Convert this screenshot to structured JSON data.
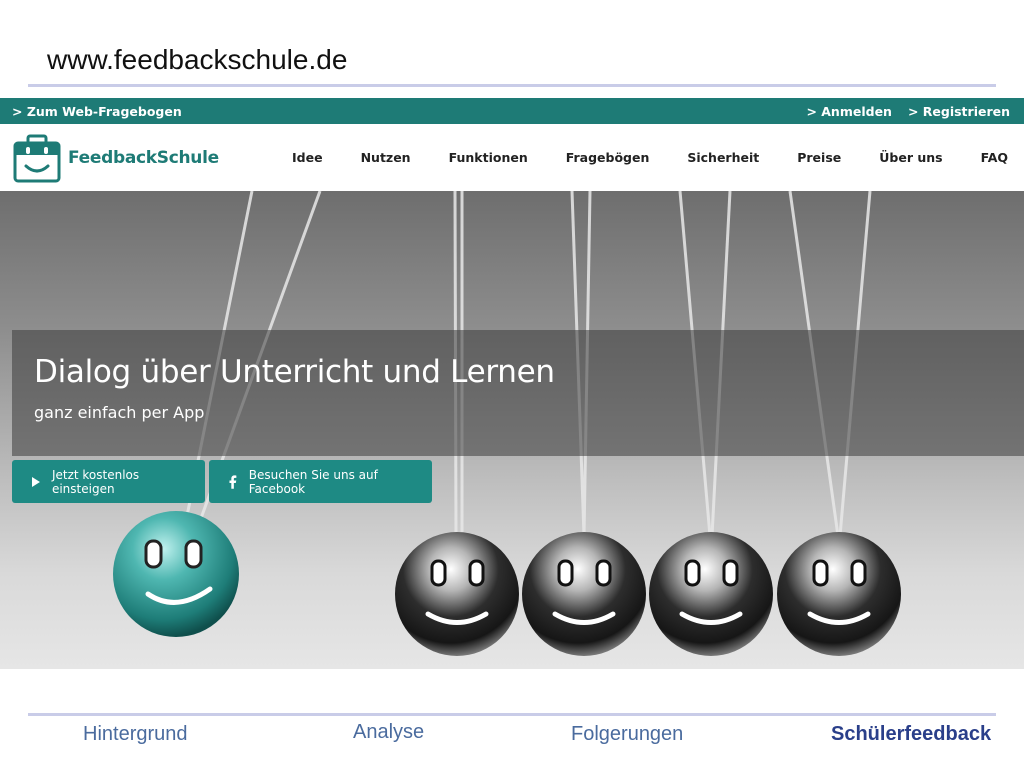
{
  "slide": {
    "url_title": "www.feedbackschule.de"
  },
  "topbar": {
    "web_survey": "> Zum Web-Fragebogen",
    "login": "> Anmelden",
    "register": "> Registrieren"
  },
  "logo": {
    "text": "FeedbackSchule",
    "icon": "briefcase-smile-icon"
  },
  "menu": [
    {
      "label": "Idee"
    },
    {
      "label": "Nutzen"
    },
    {
      "label": "Funktionen"
    },
    {
      "label": "Fragebögen"
    },
    {
      "label": "Sicherheit"
    },
    {
      "label": "Preise"
    },
    {
      "label": "Über uns"
    },
    {
      "label": "FAQ"
    }
  ],
  "hero": {
    "headline": "Dialog über Unterricht und Lernen",
    "subline": "ganz einfach per App",
    "cta_start": "Jetzt kostenlos einsteigen",
    "cta_facebook": "Besuchen Sie uns auf Facebook"
  },
  "bottom_tabs": {
    "hintergrund": "Hintergrund",
    "analyse": "Analyse",
    "folgerungen": "Folgerungen",
    "schuelerfeedback": "Schülerfeedback"
  },
  "colors": {
    "brand": "#1e7b76",
    "cta": "#1e8a84",
    "tab": "#4a6b9e",
    "tab_active": "#2a3f8a"
  }
}
